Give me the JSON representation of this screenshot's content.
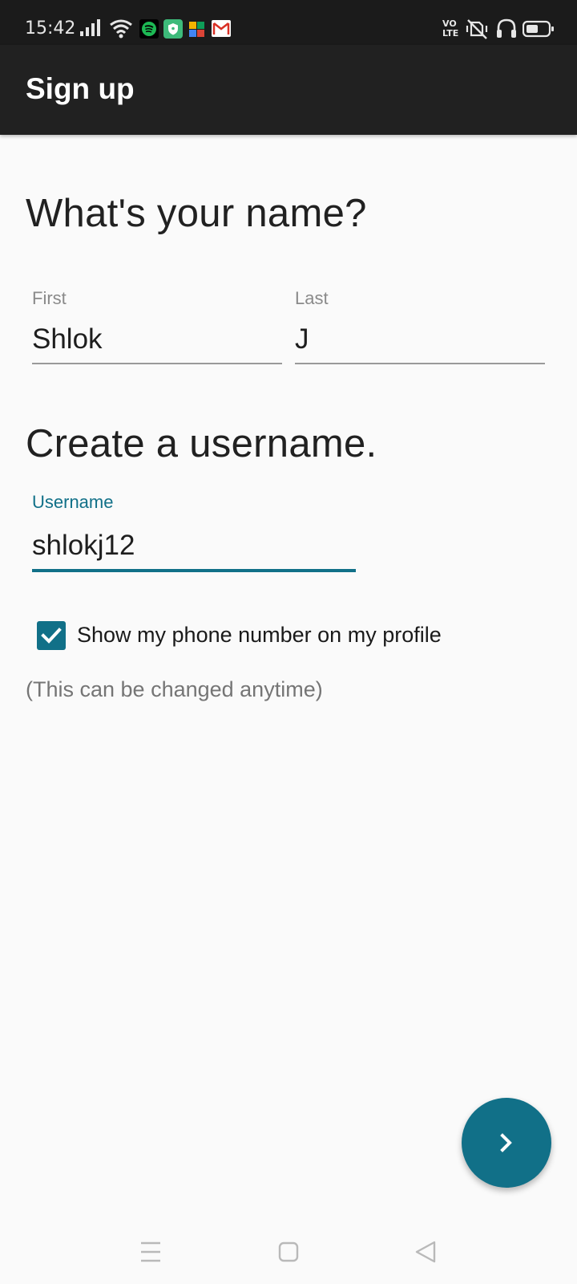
{
  "status_bar": {
    "time": "15:42",
    "left_icons": [
      "signal-icon",
      "wifi-icon",
      "spotify-icon",
      "vpn-icon",
      "puzzle-icon",
      "gmail-icon"
    ],
    "right_icons": [
      "volte-icon",
      "vibrate-off-icon",
      "headphones-icon",
      "battery-icon"
    ],
    "volte_text": "VO\nLTE"
  },
  "app_bar": {
    "title": "Sign up"
  },
  "name_section": {
    "heading": "What's your name?",
    "first": {
      "label": "First",
      "value": "Shlok"
    },
    "last": {
      "label": "Last",
      "value": "J"
    }
  },
  "username_section": {
    "heading": "Create a username.",
    "username": {
      "label": "Username",
      "value": "shlokj12"
    }
  },
  "phone_option": {
    "checked": true,
    "label": "Show my phone number on my profile",
    "hint": "(This can be changed anytime)"
  },
  "fab": {
    "icon": "chevron-right-icon"
  },
  "nav_bar": {
    "items": [
      "menu-icon",
      "home-icon",
      "back-icon"
    ]
  },
  "colors": {
    "accent": "#117088",
    "app_bar": "#212121",
    "status_bar": "#1b1b1b",
    "background": "#fafafa"
  }
}
